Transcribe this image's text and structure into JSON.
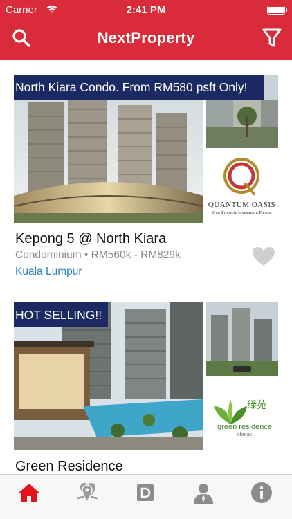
{
  "status_bar": {
    "carrier": "Carrier",
    "time": "2:41 PM"
  },
  "nav": {
    "title": "NextProperty"
  },
  "colors": {
    "brand": "#d92b3a",
    "banner": "#1c2a63",
    "link": "#2a7fc7",
    "muted": "#888888"
  },
  "listings": [
    {
      "banner": "North Kiara Condo. From RM580 psft Only!",
      "title": "Kepong 5 @ North Kiara",
      "meta": "Condominium • RM560k - RM829k",
      "location": "Kuala Lumpur",
      "logo": {
        "name": "QUANTUM OASIS",
        "tagline": "Your Property Investment Partner"
      },
      "favorited": false
    },
    {
      "banner": "HOT SELLING!!",
      "title": "Green Residence",
      "logo": {
        "name_cn": "绿苑",
        "name": "green residence",
        "sub": "cheras"
      }
    }
  ],
  "tabbar": {
    "items": [
      {
        "name": "home",
        "icon": "home-icon",
        "active": true
      },
      {
        "name": "map",
        "icon": "map-pins-icon",
        "active": false
      },
      {
        "name": "directory",
        "icon": "d-square-icon",
        "active": false
      },
      {
        "name": "profile",
        "icon": "person-icon",
        "active": false
      },
      {
        "name": "info",
        "icon": "info-icon",
        "active": false
      }
    ]
  }
}
